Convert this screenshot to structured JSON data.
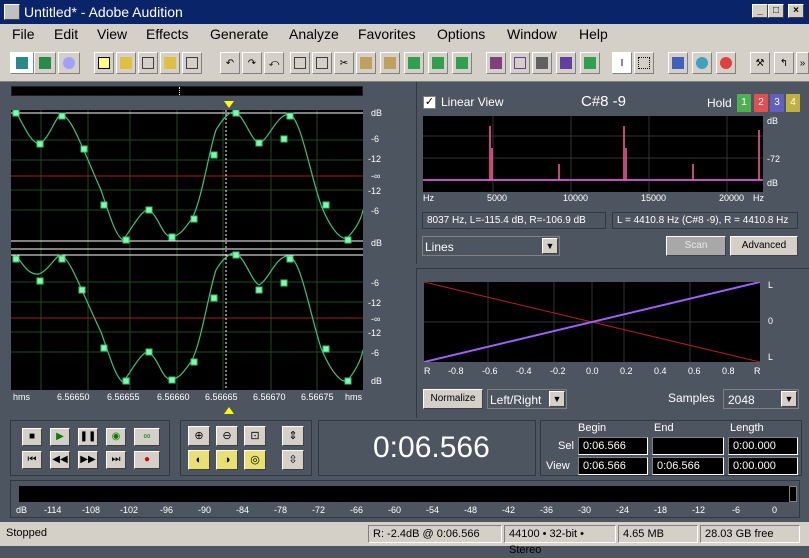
{
  "window": {
    "title": "Untitled* - Adobe Audition"
  },
  "menu": [
    "File",
    "Edit",
    "View",
    "Effects",
    "Generate",
    "Analyze",
    "Favorites",
    "Options",
    "Window",
    "Help"
  ],
  "wave": {
    "ruler_left": "hms",
    "ruler_right": "hms",
    "time_ticks": [
      "6.56650",
      "6.56655",
      "6.56660",
      "6.56665",
      "6.56670",
      "6.56675"
    ],
    "scale_top": [
      "dB",
      "-6",
      "-12",
      "-∞",
      "-12",
      "-6",
      "dB"
    ],
    "scale_bottom": [
      "-6",
      "-12",
      "-∞",
      "-12",
      "-6",
      "dB"
    ]
  },
  "spectrum": {
    "linear_label": "Linear View",
    "note": "C#8 -9",
    "hold_label": "Hold",
    "hold_buttons": [
      "1",
      "2",
      "3",
      "4"
    ],
    "db_labels": [
      "dB",
      "-72",
      "dB"
    ],
    "hz_ticks": [
      "Hz",
      "5000",
      "10000",
      "15000",
      "20000",
      "Hz"
    ],
    "readout_left": "8037 Hz, L=-115.4 dB, R=-106.9 dB",
    "readout_right": "L = 4410.8 Hz (C#8 -9), R = 4410.8 Hz",
    "mode": "Lines",
    "scan": "Scan",
    "advanced": "Advanced"
  },
  "phase": {
    "right_labels": [
      "L",
      "0",
      "L"
    ],
    "x_ticks": [
      "R",
      "-0.8",
      "-0.6",
      "-0.4",
      "-0.2",
      "0.0",
      "0.2",
      "0.4",
      "0.6",
      "0.8",
      "R"
    ],
    "normalize": "Normalize",
    "channel": "Left/Right",
    "samples_label": "Samples",
    "samples_value": "2048"
  },
  "time": {
    "display": "0:06.566"
  },
  "selection": {
    "begin_label": "Begin",
    "end_label": "End",
    "length_label": "Length",
    "sel_label": "Sel",
    "view_label": "View",
    "sel_begin": "0:06.566",
    "sel_end": "",
    "sel_length": "0:00.000",
    "view_begin": "0:06.566",
    "view_end": "0:06.566",
    "view_length": "0:00.000"
  },
  "meter": {
    "ticks": [
      "dB",
      "-114",
      "-108",
      "-102",
      "-96",
      "-90",
      "-84",
      "-78",
      "-72",
      "-66",
      "-60",
      "-54",
      "-48",
      "-42",
      "-36",
      "-30",
      "-24",
      "-18",
      "-12",
      "-6",
      "0"
    ]
  },
  "status": {
    "state": "Stopped",
    "readout": "R: -2.4dB @   0:06.566",
    "format": "44100 • 32-bit • Stereo",
    "size": "4.65 MB",
    "free": "28.03 GB free"
  }
}
